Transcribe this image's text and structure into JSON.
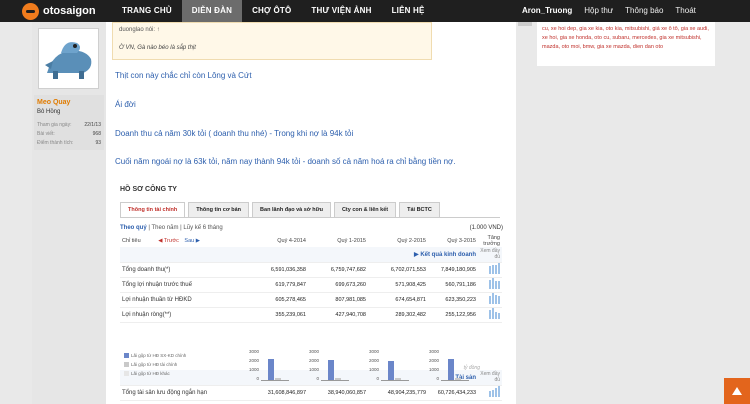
{
  "brand": {
    "name": "otosaigon"
  },
  "nav": {
    "items": [
      "TRANG CHỦ",
      "DIỄN ĐÀN",
      "CHỢ ÔTÔ",
      "THƯ VIỆN ẢNH",
      "LIÊN HỆ"
    ],
    "active_index": 1
  },
  "userbar": {
    "username": "Aron_Truong",
    "inbox": "Hộp thư",
    "alerts": "Thông báo",
    "logout": "Thoát"
  },
  "poster": {
    "name": "Meo Quay",
    "title": "Bô Hồng",
    "stats": [
      {
        "label": "Tham gia ngày:",
        "value": "22/1/13"
      },
      {
        "label": "Bài viết:",
        "value": "968"
      },
      {
        "label": "Điểm thành tích:",
        "value": "93"
      }
    ]
  },
  "quote": {
    "header": "duonglao nói: ↑",
    "body": "Ờ VN, Gà nào béo là sắp thịt"
  },
  "messages": [
    "Thịt con này chắc chỉ còn Lông và Cứt",
    "Ái đời",
    "Doanh thu cả năm 30k tỏi ( doanh thu nhé) - Trong khi nợ là 94k tỏi",
    "Cuối năm ngoái nợ là 63k tỏi, năm nay thành 94k tỏi - doanh số cả năm hoá ra chỉ bằng tiền nợ."
  ],
  "company": {
    "title": "HỒ SƠ CÔNG TY",
    "tabs": [
      "Thông tin tài chính",
      "Thông tin cơ bản",
      "Ban lãnh đạo và sở hữu",
      "Cty con & liên kết",
      "Tải BCTC"
    ],
    "period": {
      "by_quarter": "Theo quý",
      "by_year": "Theo năm",
      "cumulative": "Lũy kế 6 tháng"
    },
    "unit": "(1.000 VND)",
    "columns": {
      "metric": "Chỉ tiêu",
      "prev": "Trước",
      "next": "Sau",
      "q1": "Quý 4-2014",
      "q2": "Quý 1-2015",
      "q3": "Quý 2-2015",
      "q4": "Quý 3-2015",
      "growth": "Tăng trưởng"
    },
    "section1": {
      "title": "Kết quả kinh doanh",
      "link": "Xem đầy đủ"
    },
    "rows": [
      {
        "label": "Tổng doanh thu(*)",
        "values": [
          "6,591,036,358",
          "6,759,747,682",
          "6,702,071,553",
          "7,849,180,905"
        ]
      },
      {
        "label": "Tổng lợi nhuận trước thuế",
        "values": [
          "619,779,847",
          "699,673,260",
          "571,908,425",
          "560,791,186"
        ]
      },
      {
        "label": "Lợi nhuận thuần từ HĐKD",
        "values": [
          "605,278,465",
          "807,981,085",
          "674,654,871",
          "623,350,223"
        ]
      },
      {
        "label": "Lợi nhuận ròng(**)",
        "values": [
          "355,239,061",
          "427,940,708",
          "289,302,482",
          "255,122,956"
        ]
      }
    ],
    "legend": [
      "Lãi gộp từ HĐ SX-KD chính",
      "Lãi gộp từ HĐ tài chính",
      "Lãi gộp từ HĐ khác"
    ],
    "chart_axis": [
      "3000",
      "2000",
      "1000",
      "0"
    ],
    "ratio_label": "tỷ đồng",
    "section2": {
      "title": "Tài sản",
      "link": "Xem đầy đủ"
    },
    "asset_row": {
      "label": "Tổng tài sản lưu động ngắn hạn",
      "values": [
        "31,608,846,897",
        "38,940,060,857",
        "48,904,235,779",
        "60,726,434,233"
      ]
    }
  },
  "sidebar": {
    "tags": "cu, xe hoi dep, gia xe kia, oto kia, mitsubishi, giá xe ô tô, gia xe audi, xe hoi, gia xe honda, oto cu, subaru, mercedes, gia xe mitsubishi, mazda, oto moi, bmw, gia xe mazda, dien dan oto"
  },
  "colors": {
    "accent": "#e3651c",
    "link": "#2d5fad",
    "topbar": "#1f1f1f"
  }
}
